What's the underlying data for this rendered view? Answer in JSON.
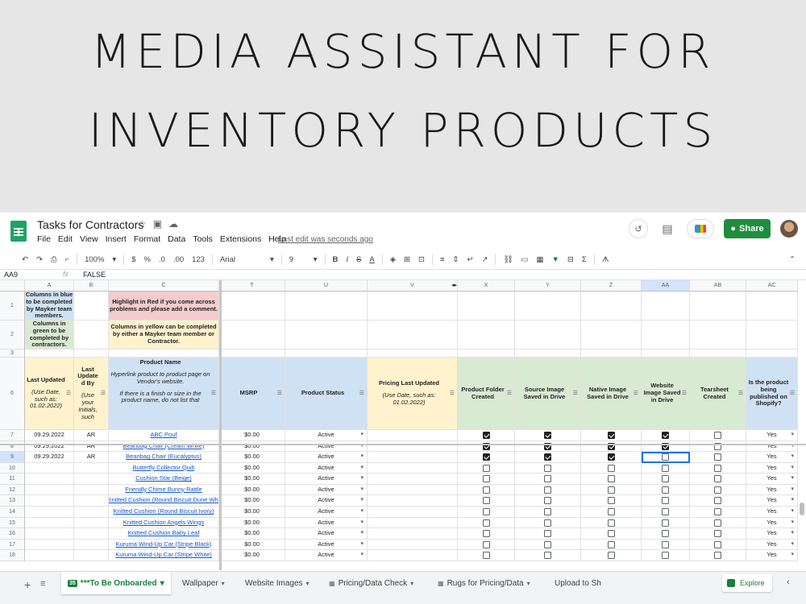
{
  "banner": {
    "line1": "MEDIA ASSISTANT FOR",
    "line2": "INVENTORY PRODUCTS"
  },
  "titlebar": {
    "doc_title": "Tasks for Contractors",
    "icons": [
      "star-icon",
      "folder-move-icon",
      "cloud-status-icon"
    ],
    "menu": [
      "File",
      "Edit",
      "View",
      "Insert",
      "Format",
      "Data",
      "Tools",
      "Extensions",
      "Help"
    ],
    "last_edit": "Last edit was seconds ago",
    "share_label": "Share"
  },
  "toolbar": {
    "zoom": "100%",
    "currency": "$",
    "percent": "%",
    "dec_less": ".0",
    "dec_more": ".00",
    "format": "123",
    "font": "Arial",
    "size": "9"
  },
  "formula": {
    "cell_ref": "AA9",
    "fx": "fx",
    "value": "FALSE"
  },
  "columns": [
    "A",
    "B",
    "C",
    "T",
    "U",
    "V",
    "X",
    "Y",
    "Z",
    "AA",
    "AB",
    "AC"
  ],
  "row_numbers": [
    "1",
    "2",
    "3",
    "6",
    "7",
    "8",
    "9",
    "10",
    "11",
    "12",
    "13",
    "14",
    "15",
    "16",
    "17",
    "18"
  ],
  "notes": {
    "blue": "Columns in blue to be completed by Mayker team members.",
    "pink": "Highlight in Red if you come across problems and please add a comment.",
    "green": "Columns in green to be completed by contractors.",
    "yellow": "Columns in yellow can be completed by either a Mayker team member or Contractor."
  },
  "headers": {
    "last_updated": "Last Updated",
    "last_updated_note": "(Use Date, such as: 01.02.2022)",
    "last_update_by": "Last Update d By",
    "last_update_by_note": "(Use your Initials, such",
    "product_name": "Product Name",
    "product_name_note1": "Hyperlink product to product page on Vendor's website.",
    "product_name_note2": "If there is a finish or size in the product name, do not list that",
    "msrp": "MSRP",
    "status": "Product Status",
    "pricing": "Pricing Last Updated",
    "pricing_note": "(Use Date, such as: 01.02.2022)",
    "folder": "Product Folder Created",
    "source": "Source Image Saved in Drive",
    "native": "Native Image Saved in Drive",
    "website": "Website Image Saved in Drive",
    "tearsheet": "Tearsheet Created",
    "published": "Is the product being published on Shopify?"
  },
  "rows": [
    {
      "date": "09.29.2022",
      "by": "AR",
      "name": "ABC Pouf",
      "msrp": "$0.00",
      "status": "Active",
      "x": true,
      "y": true,
      "z": true,
      "aa": true,
      "ab": false,
      "ac": "Yes"
    },
    {
      "date": "09.29.2022",
      "by": "AR",
      "name": "Beanbag Chair (Cream White)",
      "msrp": "$0.00",
      "status": "Active",
      "x": true,
      "y": true,
      "z": true,
      "aa": true,
      "ab": false,
      "ac": "Yes"
    },
    {
      "date": "09.29.2022",
      "by": "AR",
      "name": "Beanbag Chair (Eucalyptus)",
      "msrp": "$0.00",
      "status": "Active",
      "x": true,
      "y": true,
      "z": true,
      "aa": false,
      "ab": false,
      "ac": "Yes"
    },
    {
      "date": "",
      "by": "",
      "name": "Butterfly Collector Quilt",
      "msrp": "$0.00",
      "status": "Active",
      "x": false,
      "y": false,
      "z": false,
      "aa": false,
      "ab": false,
      "ac": "Yes"
    },
    {
      "date": "",
      "by": "",
      "name": "Cushion Star (Beige)",
      "msrp": "$0.00",
      "status": "Active",
      "x": false,
      "y": false,
      "z": false,
      "aa": false,
      "ab": false,
      "ac": "Yes"
    },
    {
      "date": "",
      "by": "",
      "name": "Friendly Chime Bunny Rattle",
      "msrp": "$0.00",
      "status": "Active",
      "x": false,
      "y": false,
      "z": false,
      "aa": false,
      "ab": false,
      "ac": "Yes"
    },
    {
      "date": "",
      "by": "",
      "name": "Knitted Cushion (Round Biscuit Dune Whi",
      "msrp": "$0.00",
      "status": "Active",
      "x": false,
      "y": false,
      "z": false,
      "aa": false,
      "ab": false,
      "ac": "Yes"
    },
    {
      "date": "",
      "by": "",
      "name": "Knitted Cushion (Round Biscuit Ivory)",
      "msrp": "$0.00",
      "status": "Active",
      "x": false,
      "y": false,
      "z": false,
      "aa": false,
      "ab": false,
      "ac": "Yes"
    },
    {
      "date": "",
      "by": "",
      "name": "Knitted Cushion Angels Wings",
      "msrp": "$0.00",
      "status": "Active",
      "x": false,
      "y": false,
      "z": false,
      "aa": false,
      "ab": false,
      "ac": "Yes"
    },
    {
      "date": "",
      "by": "",
      "name": "Knitted Cushion Baby Leaf",
      "msrp": "$0.00",
      "status": "Active",
      "x": false,
      "y": false,
      "z": false,
      "aa": false,
      "ab": false,
      "ac": "Yes"
    },
    {
      "date": "",
      "by": "",
      "name": "Kuruma Wind-Up Car (Stripe Black)",
      "msrp": "$0.00",
      "status": "Active",
      "x": false,
      "y": false,
      "z": false,
      "aa": false,
      "ab": false,
      "ac": "Yes"
    },
    {
      "date": "",
      "by": "",
      "name": "Kuruma Wind-Up Car (Stripe White)",
      "msrp": "$0.00",
      "status": "Active",
      "x": false,
      "y": false,
      "z": false,
      "aa": false,
      "ab": false,
      "ac": "Yes"
    }
  ],
  "tabs": {
    "active_badge": "35",
    "active": "***To Be Onboarded",
    "others": [
      "Wallpaper",
      "Website Images",
      "Pricing/Data Check",
      "Rugs for Pricing/Data",
      "Upload to Sh"
    ],
    "explore": "Explore"
  }
}
